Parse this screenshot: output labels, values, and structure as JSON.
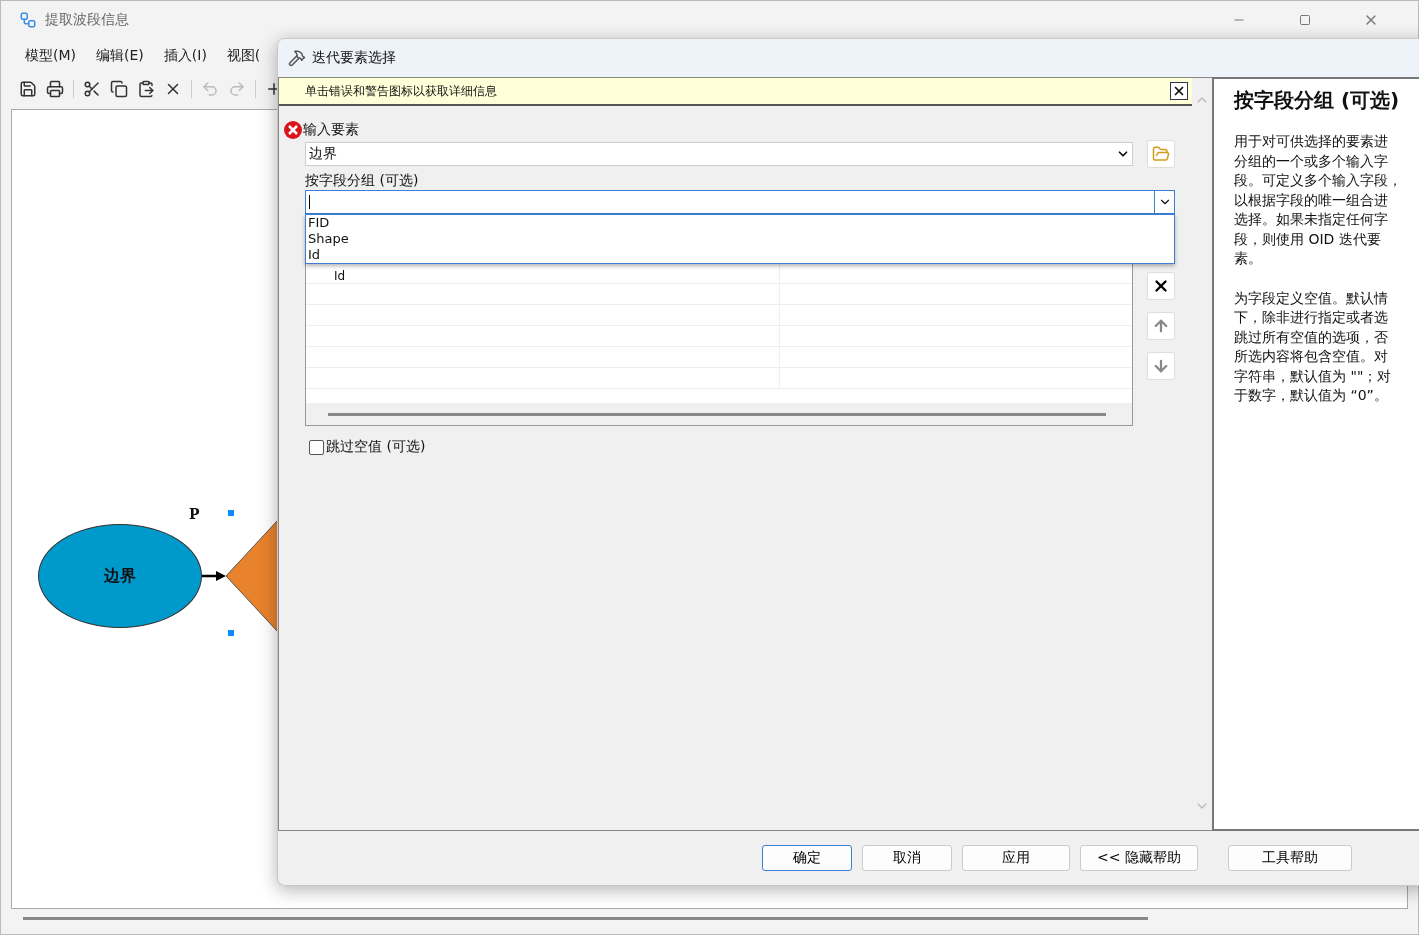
{
  "app_window": {
    "title": "提取波段信息",
    "menu": [
      "模型(M)",
      "编辑(E)",
      "插入(I)",
      "视图("
    ]
  },
  "model": {
    "parameter_label": "P",
    "nodes": [
      {
        "kind": "ellipse",
        "label": "边界"
      },
      {
        "kind": "diamond"
      }
    ]
  },
  "dialog": {
    "title": "迭代要素选择",
    "banner": "单击错误和警告图标以获取详细信息",
    "input_features": {
      "label": "输入要素",
      "value": "边界",
      "error": true
    },
    "group_by": {
      "label": "按字段分组 (可选)",
      "expanded": true,
      "options": [
        "FID",
        "Shape",
        "Id"
      ]
    },
    "table": {
      "rows": [
        {
          "field": "Id"
        }
      ]
    },
    "skip_nulls": {
      "label": "跳过空值 (可选)",
      "checked": false
    },
    "buttons": [
      {
        "label": "确定",
        "default": true
      },
      {
        "label": "取消",
        "default": false
      },
      {
        "label": "应用",
        "default": false
      },
      {
        "label": "<< 隐藏帮助",
        "default": false
      },
      {
        "label": "工具帮助",
        "default": false
      }
    ],
    "help": {
      "title": "按字段分组 (可选)",
      "paragraphs": [
        [
          "用于对可供选择的要素进",
          "分组的一个或多个输入字",
          "段。可定义多个输入字段，",
          "以根据字段的唯一组合进",
          "选择。如果未指定任何字",
          "段，则使用 OID 迭代要",
          "素。"
        ],
        [
          "为字段定义空值。默认情",
          "下，除非进行指定或者选",
          "跳过所有空值的选项，否",
          "所选内容将包含空值。对",
          "字符串，默认值为 \"\"；对",
          "于数字，默认值为 “0”。"
        ]
      ]
    }
  }
}
